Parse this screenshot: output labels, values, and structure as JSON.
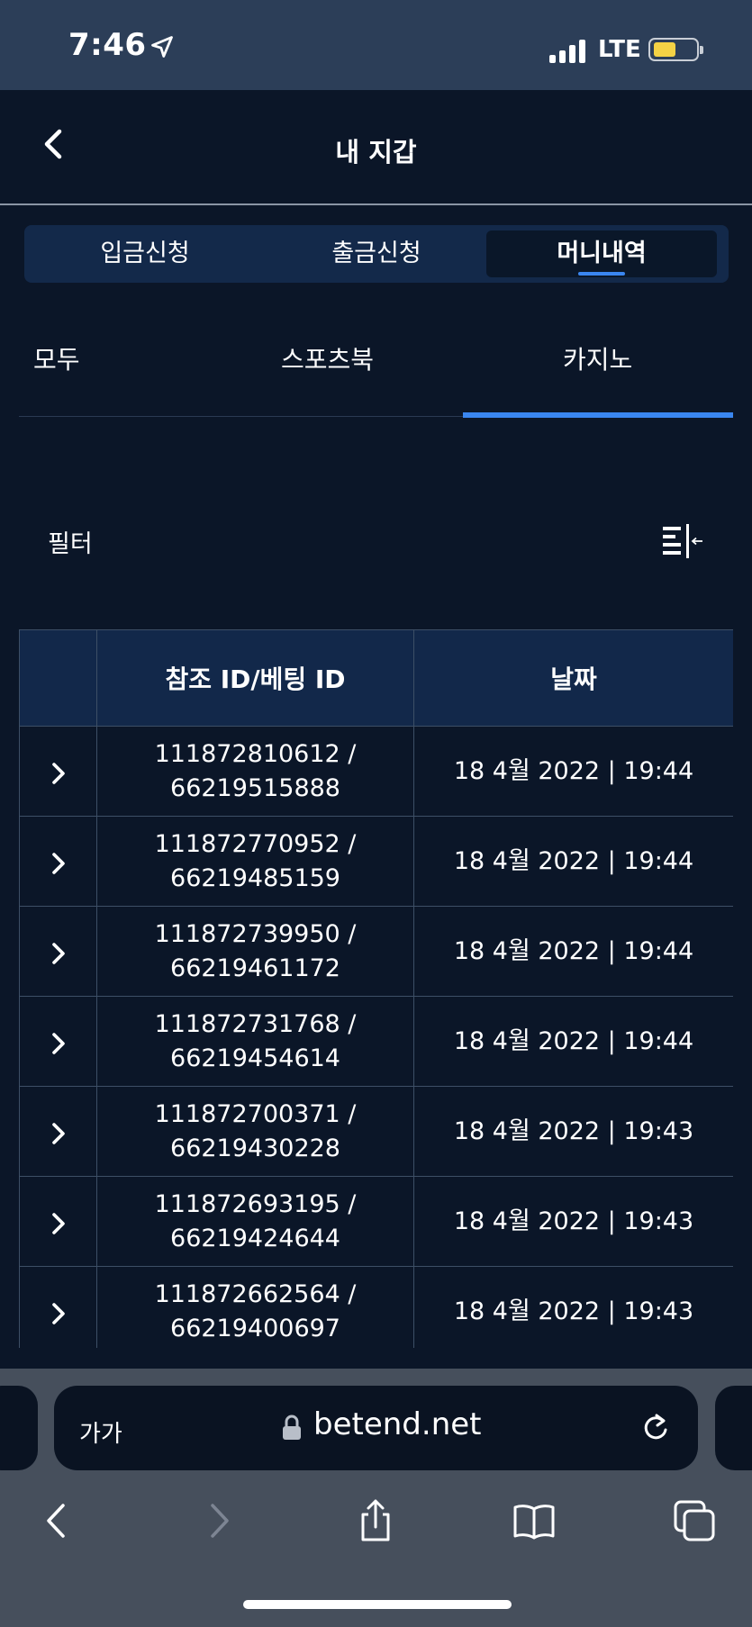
{
  "status_bar": {
    "time": "7:46",
    "network": "LTE"
  },
  "header": {
    "title": "내 지갑"
  },
  "segments": [
    {
      "label": "입금신청",
      "active": false
    },
    {
      "label": "출금신청",
      "active": false
    },
    {
      "label": "머니내역",
      "active": true
    }
  ],
  "subtabs": [
    {
      "label": "모두",
      "active": false
    },
    {
      "label": "스포츠북",
      "active": false
    },
    {
      "label": "카지노",
      "active": true
    }
  ],
  "filter": {
    "label": "필터"
  },
  "table": {
    "headers": [
      "",
      "참조 ID/베팅 ID",
      "날짜"
    ],
    "rows": [
      {
        "ref": "111872810612 /",
        "bet": "66219515888",
        "date": "18 4월 2022 | 19:44"
      },
      {
        "ref": "111872770952 /",
        "bet": "66219485159",
        "date": "18 4월 2022 | 19:44"
      },
      {
        "ref": "111872739950 /",
        "bet": "66219461172",
        "date": "18 4월 2022 | 19:44"
      },
      {
        "ref": "111872731768 /",
        "bet": "66219454614",
        "date": "18 4월 2022 | 19:44"
      },
      {
        "ref": "111872700371 /",
        "bet": "66219430228",
        "date": "18 4월 2022 | 19:43"
      },
      {
        "ref": "111872693195 /",
        "bet": "66219424644",
        "date": "18 4월 2022 | 19:43"
      },
      {
        "ref": "111872662564 /",
        "bet": "66219400697",
        "date": "18 4월 2022 | 19:43"
      }
    ]
  },
  "browser": {
    "text_size": "가가",
    "domain": "betend.net"
  },
  "colors": {
    "background": "#0b1628",
    "accent": "#3a86f0",
    "header_cell": "#12284a"
  }
}
